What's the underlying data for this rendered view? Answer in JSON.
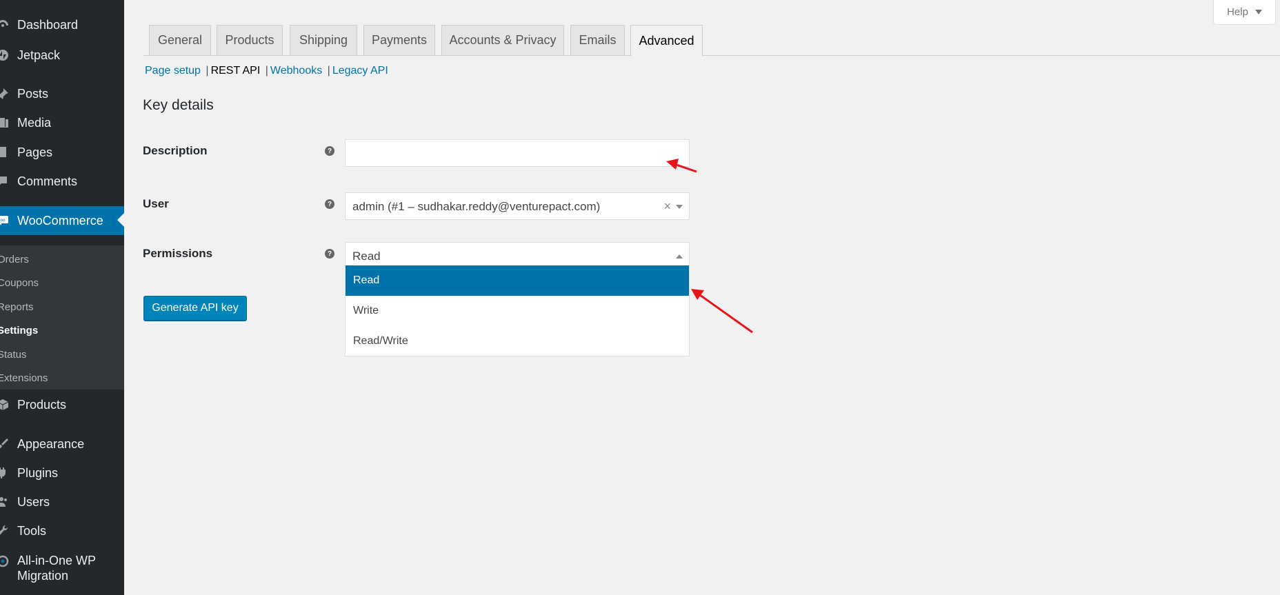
{
  "sidebar": {
    "items": [
      {
        "label": "Dashboard",
        "icon": "dashboard-icon"
      },
      {
        "label": "Jetpack",
        "icon": "jetpack-icon"
      },
      {
        "label": "Posts",
        "icon": "pin-icon"
      },
      {
        "label": "Media",
        "icon": "media-icon"
      },
      {
        "label": "Pages",
        "icon": "page-icon"
      },
      {
        "label": "Comments",
        "icon": "comment-icon"
      },
      {
        "label": "WooCommerce",
        "icon": "woocommerce-icon"
      },
      {
        "label": "Products",
        "icon": "box-icon"
      },
      {
        "label": "Appearance",
        "icon": "brush-icon"
      },
      {
        "label": "Plugins",
        "icon": "plug-icon"
      },
      {
        "label": "Users",
        "icon": "users-icon"
      },
      {
        "label": "Tools",
        "icon": "wrench-icon"
      },
      {
        "label_line1": "All-in-One WP",
        "label_line2": "Migration",
        "icon": "migration-icon"
      }
    ],
    "submenu": [
      "Orders",
      "Coupons",
      "Reports",
      "Settings",
      "Status",
      "Extensions"
    ]
  },
  "help": {
    "label": "Help"
  },
  "tabs": [
    "General",
    "Products",
    "Shipping",
    "Payments",
    "Accounts & Privacy",
    "Emails",
    "Advanced"
  ],
  "subsections": [
    "Page setup",
    "REST API",
    "Webhooks",
    "Legacy API"
  ],
  "form": {
    "title": "Key details",
    "description_label": "Description",
    "description_value": "",
    "user_label": "User",
    "user_value": "admin (#1 – sudhakar.reddy@venturepact.com)",
    "permissions_label": "Permissions",
    "permissions_value": "Read",
    "permissions_options": [
      "Read",
      "Write",
      "Read/Write"
    ],
    "help_tip": "?",
    "generate_button": "Generate API key"
  },
  "colors": {
    "accent": "#0073aa",
    "sidebar_bg": "#23282d",
    "annotation_arrow": "#e8141b"
  }
}
